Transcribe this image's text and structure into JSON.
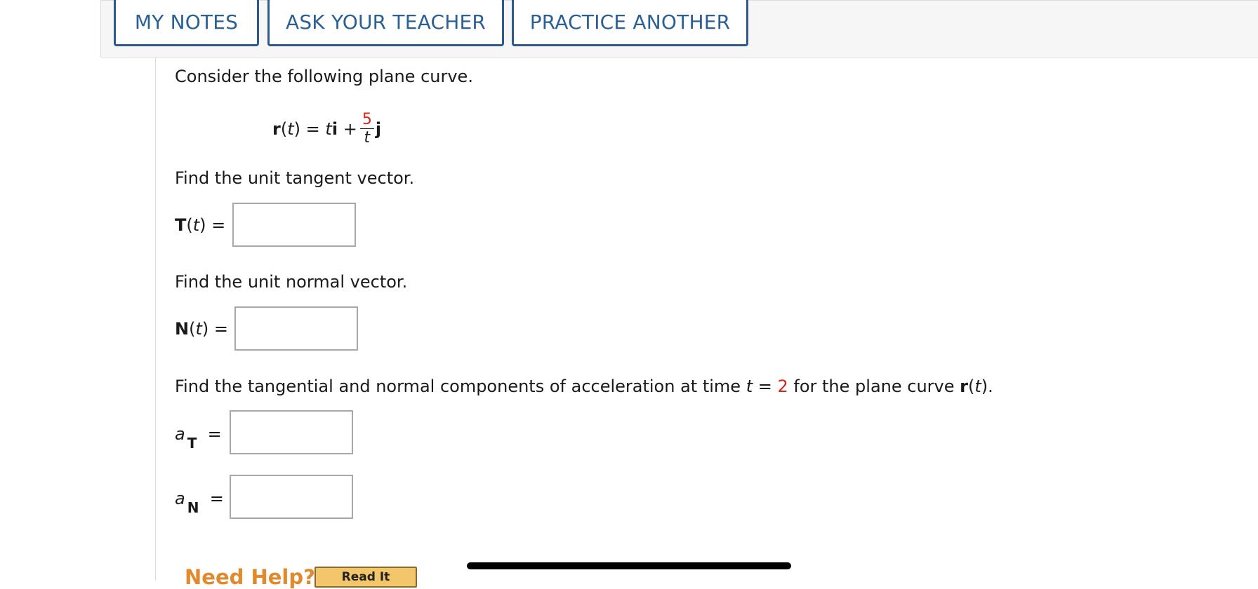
{
  "toolbar": {
    "my_notes": "MY NOTES",
    "ask_teacher": "ASK YOUR TEACHER",
    "practice_another": "PRACTICE ANOTHER"
  },
  "question": {
    "intro": "Consider the following plane curve.",
    "equation": {
      "r": "r",
      "open": "(",
      "t": "t",
      "close": ")",
      "eq": "=",
      "t2": "t",
      "i": "i",
      "plus": "+",
      "numerator": "5",
      "denominator": "t",
      "j": "j"
    },
    "part1_prompt": "Find the unit tangent vector.",
    "part1_lhs_bold": "T",
    "part1_lhs_rest_open": "(",
    "part1_lhs_var": "t",
    "part1_lhs_rest_close": ") =",
    "part2_prompt": "Find the unit normal vector.",
    "part2_lhs_bold": "N",
    "part2_lhs_rest_open": "(",
    "part2_lhs_var": "t",
    "part2_lhs_rest_close": ") =",
    "part3_prompt_a": "Find the tangential and normal components of acceleration at time ",
    "part3_t": "t",
    "part3_eq": " = ",
    "part3_value": "2",
    "part3_prompt_b": " for the plane curve ",
    "part3_r": "r",
    "part3_open": "(",
    "part3_t2": "t",
    "part3_close": ").",
    "aT_a": "a",
    "aT_sub": "T",
    "aN_a": "a",
    "aN_sub": "N",
    "equals": "="
  },
  "help": {
    "label": "Need Help?",
    "read_it": "Read It"
  },
  "colors": {
    "accent": "#2b6096",
    "value_red": "#d0261b",
    "help_orange": "#e2892b"
  }
}
